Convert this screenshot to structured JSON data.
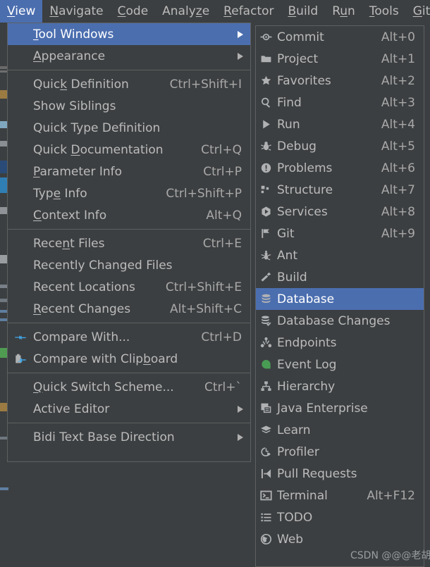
{
  "colors": {
    "background": "#3c3f41",
    "menu_background": "#3c3f41",
    "border": "#5e6060",
    "text": "#bbbbbb",
    "accent_highlight": "#4b6eaf",
    "accent_green": "#499c54",
    "accent_blue": "#40a6e6",
    "shortcut_text": "#a8a8a8"
  },
  "menubar": {
    "items": [
      {
        "label": "View",
        "mnemonic": "V",
        "active": true
      },
      {
        "label": "Navigate",
        "mnemonic": "N",
        "active": false
      },
      {
        "label": "Code",
        "mnemonic": "C",
        "active": false
      },
      {
        "label": "Analyze",
        "mnemonic": "z",
        "active": false
      },
      {
        "label": "Refactor",
        "mnemonic": "R",
        "active": false
      },
      {
        "label": "Build",
        "mnemonic": "B",
        "active": false
      },
      {
        "label": "Run",
        "mnemonic": "u",
        "active": false
      },
      {
        "label": "Tools",
        "mnemonic": "T",
        "active": false
      },
      {
        "label": "Git",
        "mnemonic": "G",
        "active": false
      }
    ]
  },
  "view_menu": {
    "name": "View",
    "items": [
      {
        "label": "Tool Windows",
        "mnemonic": "T",
        "shortcut": "",
        "submenu": true,
        "selected": true,
        "icon": "",
        "separator_after": false
      },
      {
        "label": "Appearance",
        "mnemonic": "A",
        "shortcut": "",
        "submenu": true,
        "selected": false,
        "icon": "",
        "separator_after": true
      },
      {
        "label": "Quick Definition",
        "mnemonic": "k",
        "shortcut": "Ctrl+Shift+I",
        "submenu": false,
        "selected": false,
        "icon": "",
        "separator_after": false
      },
      {
        "label": "Show Siblings",
        "mnemonic": "",
        "shortcut": "",
        "submenu": false,
        "selected": false,
        "icon": "",
        "separator_after": false
      },
      {
        "label": "Quick Type Definition",
        "mnemonic": "",
        "shortcut": "",
        "submenu": false,
        "selected": false,
        "icon": "",
        "separator_after": false
      },
      {
        "label": "Quick Documentation",
        "mnemonic": "D",
        "shortcut": "Ctrl+Q",
        "submenu": false,
        "selected": false,
        "icon": "",
        "separator_after": false
      },
      {
        "label": "Parameter Info",
        "mnemonic": "P",
        "shortcut": "Ctrl+P",
        "submenu": false,
        "selected": false,
        "icon": "",
        "separator_after": false
      },
      {
        "label": "Type Info",
        "mnemonic": "e",
        "shortcut": "Ctrl+Shift+P",
        "submenu": false,
        "selected": false,
        "icon": "",
        "separator_after": false
      },
      {
        "label": "Context Info",
        "mnemonic": "C",
        "shortcut": "Alt+Q",
        "submenu": false,
        "selected": false,
        "icon": "",
        "separator_after": true
      },
      {
        "label": "Recent Files",
        "mnemonic": "n",
        "shortcut": "Ctrl+E",
        "submenu": false,
        "selected": false,
        "icon": "",
        "separator_after": false
      },
      {
        "label": "Recently Changed Files",
        "mnemonic": "",
        "shortcut": "",
        "submenu": false,
        "selected": false,
        "icon": "",
        "separator_after": false
      },
      {
        "label": "Recent Locations",
        "mnemonic": "",
        "shortcut": "Ctrl+Shift+E",
        "submenu": false,
        "selected": false,
        "icon": "",
        "separator_after": false
      },
      {
        "label": "Recent Changes",
        "mnemonic": "R",
        "shortcut": "Alt+Shift+C",
        "submenu": false,
        "selected": false,
        "icon": "",
        "separator_after": true
      },
      {
        "label": "Compare With...",
        "mnemonic": "",
        "shortcut": "Ctrl+D",
        "submenu": false,
        "selected": false,
        "icon": "compare-icon",
        "separator_after": false
      },
      {
        "label": "Compare with Clipboard",
        "mnemonic": "b",
        "shortcut": "",
        "submenu": false,
        "selected": false,
        "icon": "compare-clipboard-icon",
        "separator_after": true
      },
      {
        "label": "Quick Switch Scheme...",
        "mnemonic": "Q",
        "shortcut": "Ctrl+`",
        "submenu": false,
        "selected": false,
        "icon": "",
        "separator_after": false
      },
      {
        "label": "Active Editor",
        "mnemonic": "",
        "shortcut": "",
        "submenu": true,
        "selected": false,
        "icon": "",
        "separator_after": true
      },
      {
        "label": "Bidi Text Base Direction",
        "mnemonic": "",
        "shortcut": "",
        "submenu": true,
        "selected": false,
        "icon": "",
        "separator_after": false
      }
    ]
  },
  "tool_windows_menu": {
    "name": "Tool Windows",
    "items": [
      {
        "label": "Commit",
        "shortcut": "Alt+0",
        "icon": "commit-icon",
        "selected": false
      },
      {
        "label": "Project",
        "shortcut": "Alt+1",
        "icon": "folder-icon",
        "selected": false
      },
      {
        "label": "Favorites",
        "shortcut": "Alt+2",
        "icon": "star-icon",
        "selected": false
      },
      {
        "label": "Find",
        "shortcut": "Alt+3",
        "icon": "search-icon",
        "selected": false
      },
      {
        "label": "Run",
        "shortcut": "Alt+4",
        "icon": "play-icon",
        "selected": false
      },
      {
        "label": "Debug",
        "shortcut": "Alt+5",
        "icon": "bug-icon",
        "selected": false
      },
      {
        "label": "Problems",
        "shortcut": "Alt+6",
        "icon": "problems-icon",
        "selected": false
      },
      {
        "label": "Structure",
        "shortcut": "Alt+7",
        "icon": "structure-icon",
        "selected": false
      },
      {
        "label": "Services",
        "shortcut": "Alt+8",
        "icon": "services-icon",
        "selected": false
      },
      {
        "label": "Git",
        "shortcut": "Alt+9",
        "icon": "git-branch-icon",
        "selected": false
      },
      {
        "label": "Ant",
        "shortcut": "",
        "icon": "ant-icon",
        "selected": false
      },
      {
        "label": "Build",
        "shortcut": "",
        "icon": "hammer-icon",
        "selected": false
      },
      {
        "label": "Database",
        "shortcut": "",
        "icon": "database-icon",
        "selected": true
      },
      {
        "label": "Database Changes",
        "shortcut": "",
        "icon": "database-changes-icon",
        "selected": false
      },
      {
        "label": "Endpoints",
        "shortcut": "",
        "icon": "endpoints-icon",
        "selected": false
      },
      {
        "label": "Event Log",
        "shortcut": "",
        "icon": "event-log-icon",
        "selected": false
      },
      {
        "label": "Hierarchy",
        "shortcut": "",
        "icon": "hierarchy-icon",
        "selected": false
      },
      {
        "label": "Java Enterprise",
        "shortcut": "",
        "icon": "java-enterprise-icon",
        "selected": false
      },
      {
        "label": "Learn",
        "shortcut": "",
        "icon": "learn-icon",
        "selected": false
      },
      {
        "label": "Profiler",
        "shortcut": "",
        "icon": "profiler-icon",
        "selected": false
      },
      {
        "label": "Pull Requests",
        "shortcut": "",
        "icon": "pull-requests-icon",
        "selected": false
      },
      {
        "label": "Terminal",
        "shortcut": "Alt+F12",
        "icon": "terminal-icon",
        "selected": false
      },
      {
        "label": "TODO",
        "shortcut": "",
        "icon": "todo-icon",
        "selected": false
      },
      {
        "label": "Web",
        "shortcut": "",
        "icon": "web-icon",
        "selected": false
      }
    ]
  },
  "watermark": {
    "text": "CSDN @@@老胡"
  }
}
